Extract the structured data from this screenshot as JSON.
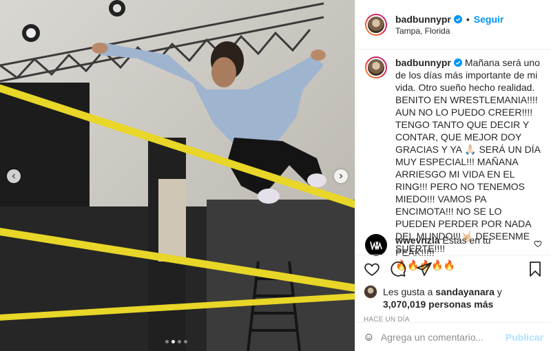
{
  "post": {
    "username": "badbunnypr",
    "follow_label": "Seguir",
    "location": "Tampa, Florida",
    "caption": "Mañana será uno de los días más importante de mi vida. Otro sueño hecho realidad. BENITO EN WRESTLEMANIA!!!! AUN NO LO PUEDO CREER!!!! TENGO TANTO QUE DECIR Y CONTAR, QUE MEJOR DOY GRACIAS Y YA 🙏🏻 SERÁ UN DÍA MUY ESPECIAL!!! MAÑANA ARRIESGO MI VIDA EN EL RING!!! PERO NO TENEMOS MIEDO!!! VAMOS PA ENCIMOTA!!! NO SE LO PUEDEN PERDER POR NADA DEL MUNDO!!!🤘🏻 DESEENME SUERTE!!!!",
    "time_ago": "1 d"
  },
  "comment": {
    "username": "wwevnzla",
    "text": "Estás en tu PEAK!!!!!",
    "emojis": "🔥🔥🔥🔥🔥"
  },
  "likes": {
    "prefix": "Les gusta a",
    "user": "sandayanara",
    "connector": "y",
    "count": "3,070,019 personas más"
  },
  "posted": "HACE UN DÍA",
  "composer": {
    "placeholder": "Agrega un comentario...",
    "post_label": "Publicar"
  },
  "carousel": {
    "count": 4,
    "current": 2
  },
  "colors": {
    "accent": "#0095f6",
    "muted": "#8e8e8e",
    "rope": "#e8d628"
  }
}
